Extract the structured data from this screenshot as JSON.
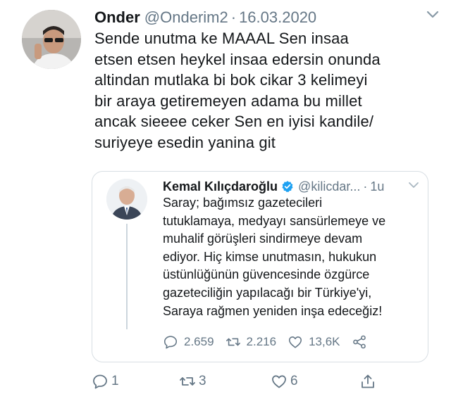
{
  "tweet": {
    "author_name": "Onder",
    "handle": "@Onderim2",
    "separator": "·",
    "date": "16.03.2020",
    "text_lines": [
      "Sende unutma ke MAAAL Sen insaa",
      "etsen etsen heykel insaa edersin onunda",
      "altindan mutlaka bi bok cikar 3 kelimeyi",
      "bir araya getiremeyen adama bu millet",
      "ancak sieeee ceker Sen en iyisi kandile/",
      "suriyeye esedin yanina git"
    ],
    "replies": "1",
    "retweets": "3",
    "likes": "6"
  },
  "quoted": {
    "author_name": "Kemal Kılıçdaroğlu",
    "handle": "@kilicdar...",
    "separator": "·",
    "time": "1u",
    "text_lines": [
      "Saray; bağımsız gazetecileri",
      "tutuklamaya, medyayı sansürlemeye ve",
      "muhalif görüşleri sindirmeye devam",
      "ediyor. Hiç kimse unutmasın, hukukun",
      "üstünlüğünün güvencesinde özgürce",
      "gazeteciliğin yapılacağı bir Türkiye'yi,",
      "Saraya rağmen yeniden inşa edeceğiz!"
    ],
    "replies": "2.659",
    "retweets": "2.216",
    "likes": "13,6K"
  },
  "colors": {
    "text": "#14171a",
    "secondary": "#657786",
    "border": "#d8dee3",
    "verified": "#1da1f2"
  },
  "icons": [
    "chevron-down-icon",
    "verified-badge-icon",
    "reply-icon",
    "retweet-icon",
    "like-icon",
    "share-icon"
  ]
}
